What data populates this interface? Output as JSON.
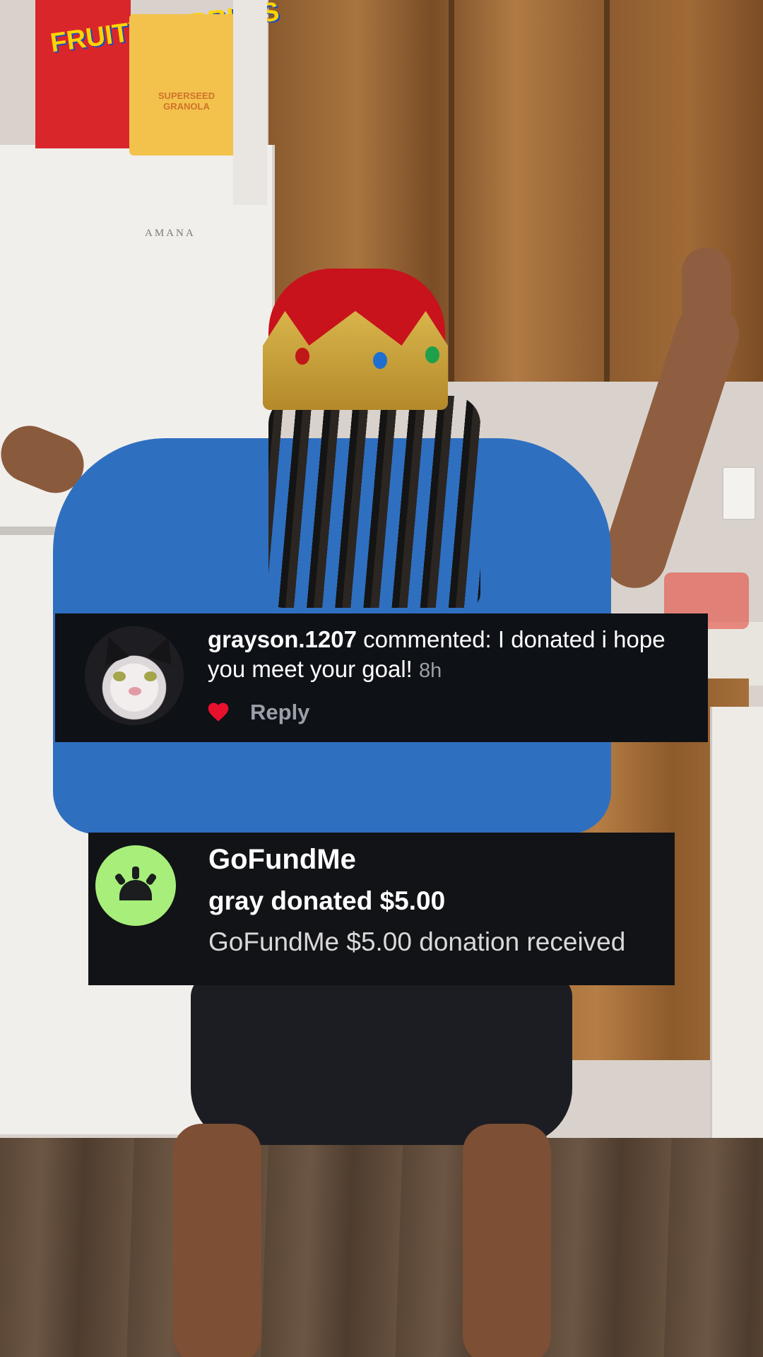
{
  "background": {
    "fridge_brand": "AMANA",
    "cereal_box_a": "FRUITY PEBBLES",
    "cereal_box_b": "SUPERSEED GRANOLA"
  },
  "comment": {
    "username": "grayson.1207",
    "action": " commented: ",
    "text": "I donated i hope you meet your goal! ",
    "time": "8h",
    "reply_label": "Reply",
    "heart_color": "#e8112d",
    "avatar_icon": "cat-avatar"
  },
  "gofundme": {
    "title": "GoFundMe",
    "donation_line": "gray donated $5.00",
    "receipt_line": "GoFundMe $5.00 donation received",
    "logo_color": "#a7ef7a",
    "logo_icon": "gofundme-logo-icon"
  }
}
